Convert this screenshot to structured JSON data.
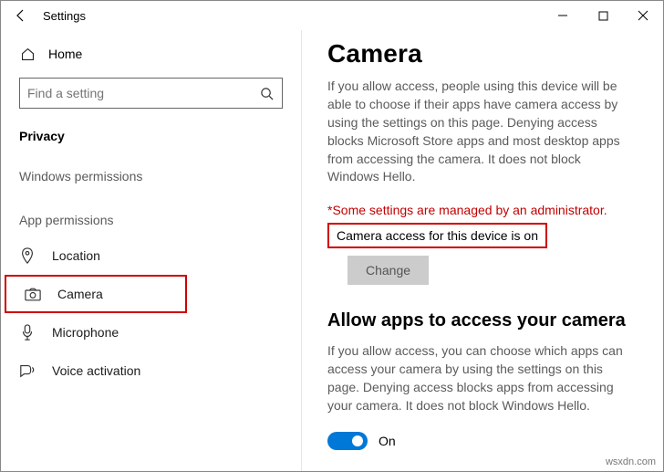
{
  "window": {
    "title": "Settings"
  },
  "nav": {
    "home": "Home",
    "search_placeholder": "Find a setting",
    "section": "Privacy",
    "group_windows": "Windows permissions",
    "group_app": "App permissions",
    "items": {
      "location": "Location",
      "camera": "Camera",
      "microphone": "Microphone",
      "voice": "Voice activation"
    }
  },
  "main": {
    "heading": "Camera",
    "intro": "If you allow access, people using this device will be able to choose if their apps have camera access by using the settings on this page. Denying access blocks Microsoft Store apps and most desktop apps from accessing the camera. It does not block Windows Hello.",
    "admin_note": "*Some settings are managed by an administrator.",
    "status": "Camera access for this device is on",
    "change_label": "Change",
    "sub_heading": "Allow apps to access your camera",
    "sub_intro": "If you allow access, you can choose which apps can access your camera by using the settings on this page. Denying access blocks apps from accessing your camera. It does not block Windows Hello.",
    "toggle_label": "On"
  },
  "watermark": "wsxdn.com"
}
